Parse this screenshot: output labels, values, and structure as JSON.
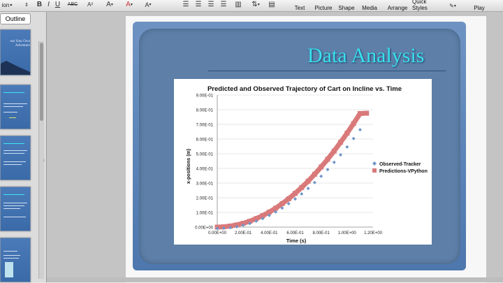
{
  "ribbon": {
    "menu_fragment": "ion",
    "outline_tab": "Outline",
    "format_buttons": [
      "B",
      "I",
      "U",
      "ABC",
      "A²",
      "A",
      "A"
    ],
    "insert_buttons": [
      "Text",
      "Picture",
      "Shape",
      "Media"
    ],
    "arrange_label": "Arrange",
    "quick_styles_label": "Quick Styles",
    "play_label": "Play"
  },
  "sidebar": {
    "thumb1_text": "ose Your Own Adventure"
  },
  "slide": {
    "title": "Data Analysis"
  },
  "colors": {
    "slide_frame": "#5d7fa8",
    "title_color": "#39e0ee",
    "observed_series": "#6f95c9",
    "predicted_series": "#d9797a"
  },
  "chart_data": {
    "type": "scatter",
    "title": "Predicted and  Observed Trajectory of Cart on Incline vs. Time",
    "xlabel": "Time (s)",
    "ylabel": "x-positions (m)",
    "xlim": [
      0,
      1.2
    ],
    "ylim": [
      0,
      0.9
    ],
    "x_ticks": [
      "0.00E+00",
      "2.00E-01",
      "4.00E-01",
      "6.00E-01",
      "8.00E-01",
      "1.00E+00",
      "1.20E+00"
    ],
    "y_ticks": [
      "0.00E+00",
      "1.00E-01",
      "2.00E-01",
      "3.00E-01",
      "4.00E-01",
      "5.00E-01",
      "6.00E-01",
      "7.00E-01",
      "8.00E-01",
      "9.00E-01"
    ],
    "legend_position": "right",
    "series": [
      {
        "name": "Observed-Tracker",
        "x": [
          0.0,
          0.05,
          0.1,
          0.15,
          0.2,
          0.25,
          0.3,
          0.35,
          0.4,
          0.45,
          0.5,
          0.55,
          0.6,
          0.65,
          0.7,
          0.75,
          0.8,
          0.85,
          0.9,
          0.95,
          1.0,
          1.05,
          1.1
        ],
        "y": [
          0.0,
          0.002,
          0.006,
          0.012,
          0.022,
          0.034,
          0.05,
          0.068,
          0.089,
          0.113,
          0.139,
          0.169,
          0.201,
          0.236,
          0.273,
          0.313,
          0.356,
          0.402,
          0.451,
          0.502,
          0.556,
          0.613,
          0.673
        ]
      },
      {
        "name": "Predictions-VPython",
        "x": [
          0.0,
          0.05,
          0.1,
          0.15,
          0.2,
          0.25,
          0.3,
          0.35,
          0.4,
          0.45,
          0.5,
          0.55,
          0.6,
          0.65,
          0.7,
          0.75,
          0.8,
          0.85,
          0.9,
          0.95,
          1.0,
          1.05,
          1.1,
          1.15
        ],
        "y": [
          0.0,
          0.002,
          0.007,
          0.015,
          0.026,
          0.04,
          0.058,
          0.078,
          0.102,
          0.129,
          0.16,
          0.193,
          0.23,
          0.27,
          0.313,
          0.36,
          0.41,
          0.462,
          0.518,
          0.578,
          0.64,
          0.706,
          0.774,
          0.776
        ]
      }
    ]
  }
}
